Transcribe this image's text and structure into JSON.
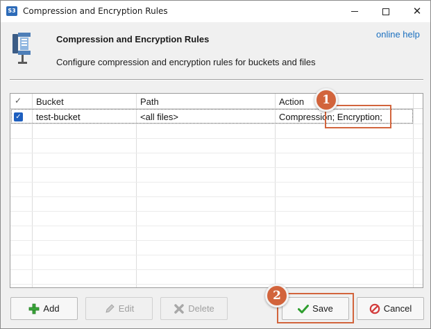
{
  "window": {
    "title": "Compression and Encryption Rules",
    "app_icon_text": "S3"
  },
  "header": {
    "title": "Compression and Encryption Rules",
    "description": "Configure compression and encryption rules for buckets and files",
    "online_help": "online help"
  },
  "grid": {
    "columns": [
      "Bucket",
      "Path",
      "Action"
    ],
    "check_header": "✓",
    "rows": [
      {
        "checked": true,
        "bucket": "test-bucket",
        "path": "<all files>",
        "action": "Compression; Encryption;"
      }
    ]
  },
  "buttons": {
    "add": "Add",
    "edit": "Edit",
    "delete": "Delete",
    "save": "Save",
    "cancel": "Cancel"
  },
  "callouts": [
    "1",
    "2"
  ],
  "colors": {
    "callout": "#d2643c",
    "link": "#1a6fbf",
    "checkbox": "#1e5fbf"
  }
}
